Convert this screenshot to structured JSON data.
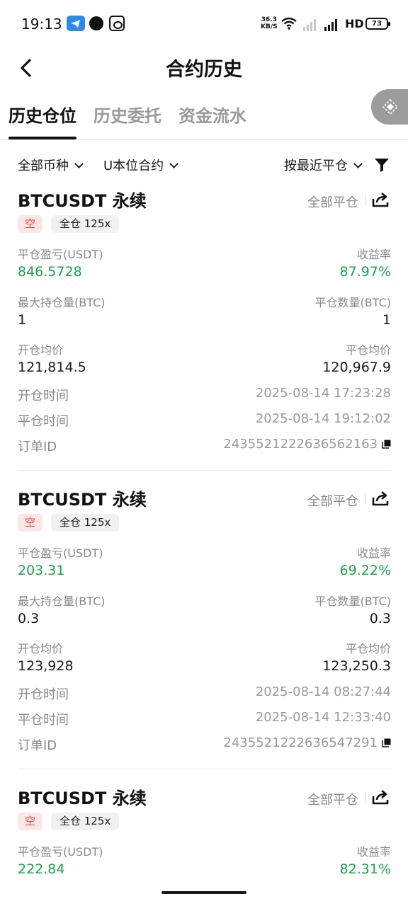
{
  "status_bar": {
    "time": "19:13",
    "net_speed_value": "36.3",
    "net_speed_unit": "KB/S",
    "network_label": "HD",
    "battery": "73"
  },
  "header": {
    "title": "合约历史"
  },
  "tabs": [
    {
      "label": "历史仓位",
      "active": true
    },
    {
      "label": "历史委托",
      "active": false
    },
    {
      "label": "资金流水",
      "active": false
    }
  ],
  "filters": {
    "coin": "全部币种",
    "contract_type": "U本位合约",
    "sort": "按最近平仓"
  },
  "labels": {
    "pnl": "平仓盈亏(USDT)",
    "roi": "收益率",
    "max_position": "最大持仓量(BTC)",
    "close_qty": "平仓数量(BTC)",
    "open_avg": "开仓均价",
    "close_avg": "平仓均价",
    "open_time": "开仓时间",
    "close_time": "平仓时间",
    "order_id": "订单ID"
  },
  "positions": [
    {
      "symbol": "BTCUSDT 永续",
      "close_type": "全部平仓",
      "side": "空",
      "margin_mode": "全仓 125x",
      "pnl": "846.5728",
      "roi": "87.97%",
      "max_position": "1",
      "close_qty": "1",
      "open_avg": "121,814.5",
      "close_avg": "120,967.9",
      "open_time": "2025-08-14 17:23:28",
      "close_time": "2025-08-14 19:12:02",
      "order_id": "2435521222636562163"
    },
    {
      "symbol": "BTCUSDT 永续",
      "close_type": "全部平仓",
      "side": "空",
      "margin_mode": "全仓 125x",
      "pnl": "203.31",
      "roi": "69.22%",
      "max_position": "0.3",
      "close_qty": "0.3",
      "open_avg": "123,928",
      "close_avg": "123,250.3",
      "open_time": "2025-08-14 08:27:44",
      "close_time": "2025-08-14 12:33:40",
      "order_id": "2435521222636547291"
    },
    {
      "symbol": "BTCUSDT 永续",
      "close_type": "全部平仓",
      "side": "空",
      "margin_mode": "全仓 125x",
      "pnl": "222.84",
      "roi": "82.31%"
    }
  ],
  "colors": {
    "profit_green": "#1aa34a",
    "short_red": "#e2453b",
    "short_bg": "#fde7e6",
    "muted_text": "#8a8a8a"
  },
  "icons": [
    "back-arrow-icon",
    "filter-funnel-icon",
    "share-icon",
    "copy-icon",
    "chevron-down-icon",
    "float-diamond-icon"
  ]
}
